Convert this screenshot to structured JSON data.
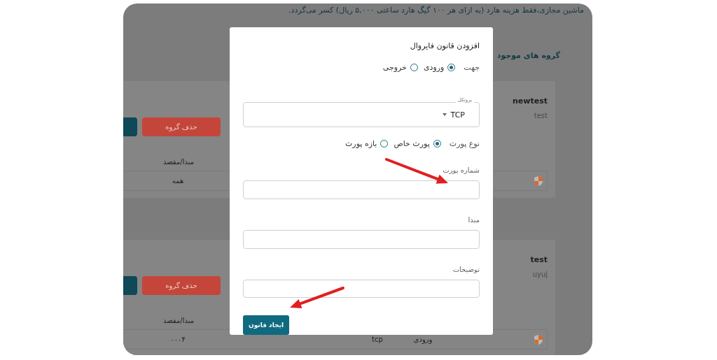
{
  "page": {
    "notice": "ماشین مجازی،فقط هزینه هارد (به ازای هر ۱۰۰ گیگ هارد ساعتی ۵,۰۰۰ ریال) کسر می‌گردد.",
    "heading": "گروه های موجود",
    "groups": [
      {
        "name": "newtest",
        "description": "test",
        "delete_button": "حذف گروه",
        "column_header": "مبدا/مقصد",
        "row": {
          "source": "همه"
        }
      },
      {
        "name": "test",
        "description": "uyuj",
        "delete_button": "حذف گروه",
        "column_header": "مبدا/مقصد",
        "row": {
          "direction": "ورودی",
          "protocol": "tcp",
          "source": "۰۰۰۴"
        }
      }
    ]
  },
  "dialog": {
    "title": "افزودن قانون فایروال",
    "direction": {
      "label": "جهت",
      "options": [
        {
          "label": "ورودی",
          "selected": true
        },
        {
          "label": "خروجی",
          "selected": false
        }
      ]
    },
    "protocol": {
      "label": "پروتکل",
      "value": "TCP"
    },
    "port_type": {
      "label": "نوع پورت",
      "options": [
        {
          "label": "پورت خاص",
          "selected": true
        },
        {
          "label": "بازه پورت",
          "selected": false
        }
      ]
    },
    "fields": [
      {
        "label": "شماره پورت"
      },
      {
        "label": "مبدا"
      },
      {
        "label": "توضیحات"
      }
    ],
    "submit": "ایجاد قانون"
  },
  "annotations": [
    {
      "kind": "arrow"
    },
    {
      "kind": "arrow"
    }
  ]
}
